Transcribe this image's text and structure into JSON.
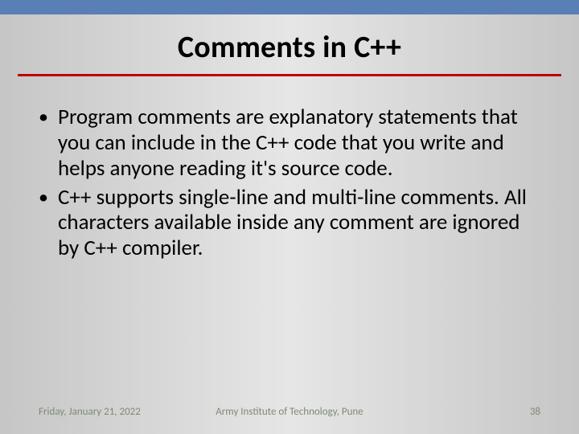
{
  "title": "Comments in C++",
  "bullets": [
    "Program comments are explanatory statements that you can include in the C++ code that you write and helps anyone reading it's source code.",
    "C++ supports single-line and multi-line comments. All characters available inside any comment are ignored by C++ compiler."
  ],
  "footer": {
    "date": "Friday, January 21, 2022",
    "center": "Army Institute of Technology, Pune",
    "page": "38"
  }
}
